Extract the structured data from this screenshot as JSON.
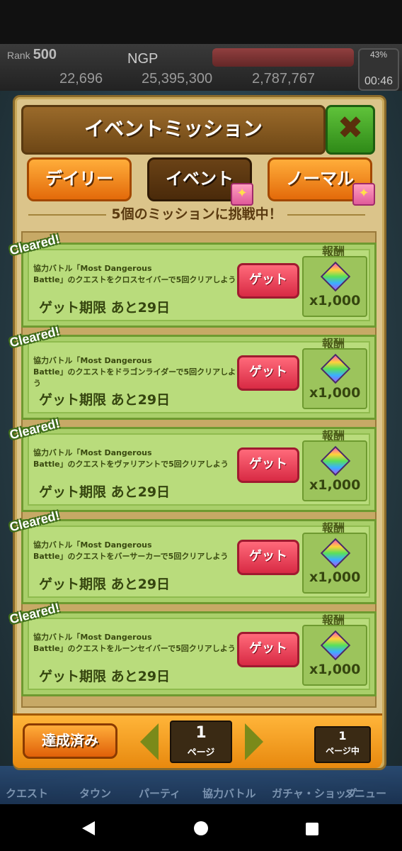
{
  "header": {
    "rank_label": "Rank",
    "rank_value": "500",
    "player_name": "NGP",
    "stat1": "22,696",
    "stat2": "25,395,300",
    "stat3": "2,787,767",
    "battery": "43%",
    "time": "00:46"
  },
  "bottom_nav": [
    "クエスト",
    "タウン",
    "パーティ",
    "協力バトル",
    "ガチャ・ショップ",
    "メニュー"
  ],
  "modal": {
    "title": "イベントミッション",
    "close_label": "✖",
    "tabs": [
      {
        "label": "デイリー",
        "gift": false
      },
      {
        "label": "イベント",
        "gift": true
      },
      {
        "label": "ノーマル",
        "gift": true
      }
    ],
    "challenge_text": "5個のミッションに挑戦中！",
    "missions": [
      {
        "cleared": "Cleared!",
        "line1": "協力バトル「Most Dangerous",
        "line2": "Battle」のクエストをクロスセイバーで5回クリアしよう",
        "get": "ゲット",
        "deadline": "ゲット期限 あと29日",
        "reward_label": "報酬",
        "qty": "x1,000"
      },
      {
        "cleared": "Cleared!",
        "line1": "協力バトル「Most Dangerous",
        "line2": "Battle」のクエストをドラゴンライダーで5回クリアしよう",
        "get": "ゲット",
        "deadline": "ゲット期限 あと29日",
        "reward_label": "報酬",
        "qty": "x1,000"
      },
      {
        "cleared": "Cleared!",
        "line1": "協力バトル「Most Dangerous",
        "line2": "Battle」のクエストをヴァリアントで5回クリアしよう",
        "get": "ゲット",
        "deadline": "ゲット期限 あと29日",
        "reward_label": "報酬",
        "qty": "x1,000"
      },
      {
        "cleared": "Cleared!",
        "line1": "協力バトル「Most Dangerous",
        "line2": "Battle」のクエストをバーサーカーで5回クリアしよう",
        "get": "ゲット",
        "deadline": "ゲット期限 あと29日",
        "reward_label": "報酬",
        "qty": "x1,000"
      },
      {
        "cleared": "Cleared!",
        "line1": "協力バトル「Most Dangerous",
        "line2": "Battle」のクエストをルーンセイバーで5回クリアしよう",
        "get": "ゲット",
        "deadline": "ゲット期限 あと29日",
        "reward_label": "報酬",
        "qty": "x1,000"
      }
    ],
    "footer": {
      "done_label": "達成済み",
      "page_number": "1",
      "page_unit": "ページ",
      "total_pages": "1",
      "total_unit": "ページ中"
    }
  }
}
